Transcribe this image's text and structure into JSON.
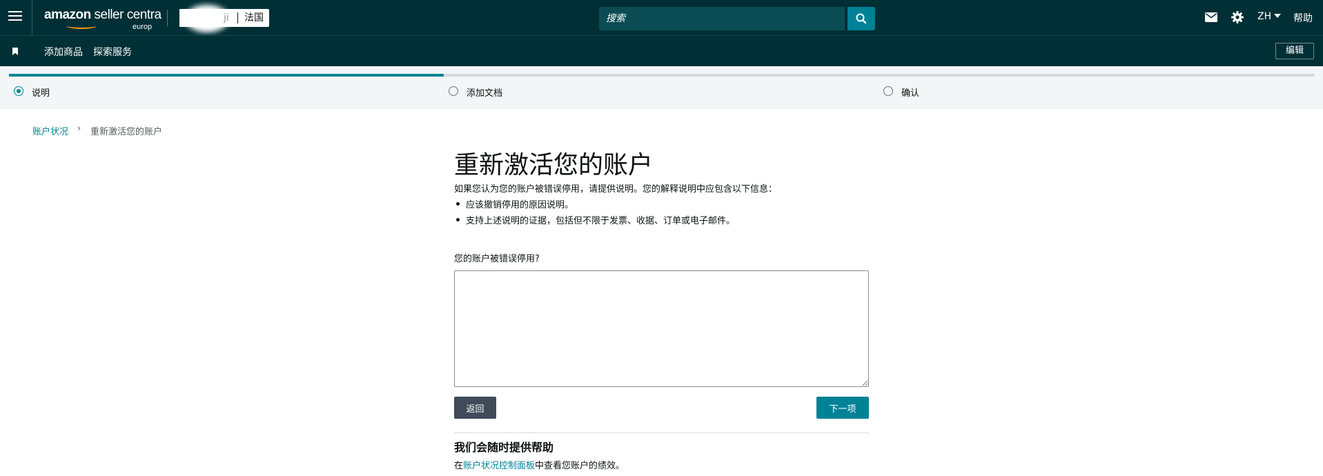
{
  "header": {
    "logo_main": "amazon",
    "logo_product": "seller centra",
    "logo_region": "europ",
    "account_partial": "ji",
    "marketplace": "法国",
    "search_placeholder": "搜索",
    "language": "ZH",
    "help": "帮助"
  },
  "nav": {
    "items": [
      {
        "label": "添加商品"
      },
      {
        "label": "探索服务"
      }
    ],
    "edit": "编辑"
  },
  "stepper": {
    "progress_fraction": 0.333,
    "steps": [
      {
        "label": "说明",
        "active": true
      },
      {
        "label": "添加文档",
        "active": false
      },
      {
        "label": "确认",
        "active": false
      }
    ]
  },
  "breadcrumb": {
    "parent": "账户状况",
    "current": "重新激活您的账户"
  },
  "main": {
    "title": "重新激活您的账户",
    "intro": "如果您认为您的账户被错误停用，请提供说明。您的解释说明中应包含以下信息：",
    "bullets": [
      "应该撤销停用的原因说明。",
      "支持上述说明的证据，包括但不限于发票、收据、订单或电子邮件。"
    ],
    "question": "您的账户被错误停用?",
    "answer_value": "",
    "back_button": "返回",
    "next_button": "下一项"
  },
  "help_section": {
    "title": "我们会随时提供帮助",
    "text_prefix": "在",
    "link": "账户状况控制面板",
    "text_suffix": "中查看您账户的绩效。"
  },
  "colors": {
    "header_bg": "#002f36",
    "accent": "#008296",
    "search_bg": "#0b4c54",
    "secondary_button": "#3f4b59"
  }
}
